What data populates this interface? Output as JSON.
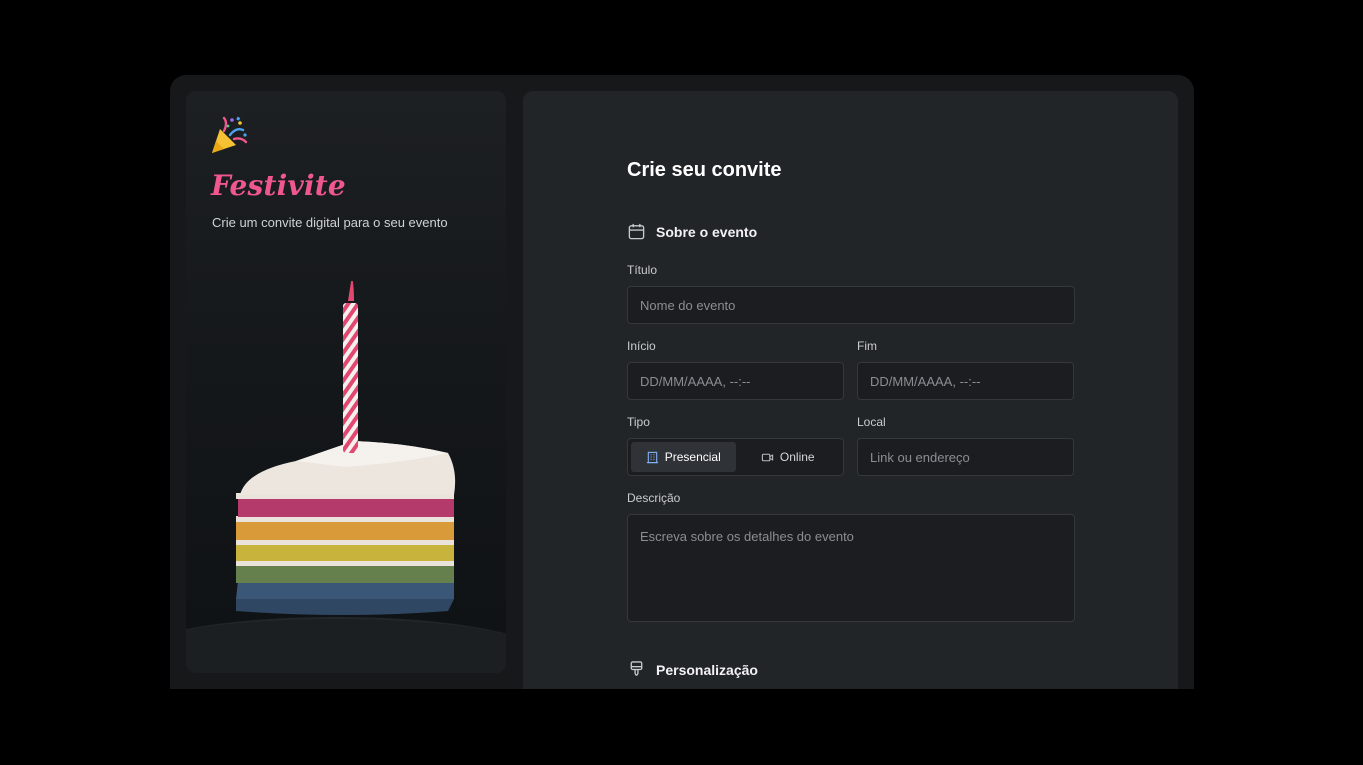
{
  "brand": {
    "name": "Festivite",
    "tagline": "Crie um convite digital para o seu evento",
    "logo_icon": "party-popper-icon",
    "accent_color": "#f0578f"
  },
  "form": {
    "title": "Crie seu convite",
    "section_event": {
      "title": "Sobre o evento",
      "icon": "calendar-icon"
    },
    "fields": {
      "titulo": {
        "label": "Título",
        "placeholder": "Nome do evento"
      },
      "inicio": {
        "label": "Início",
        "placeholder": "DD/MM/AAAA, --:--"
      },
      "fim": {
        "label": "Fim",
        "placeholder": "DD/MM/AAAA, --:--"
      },
      "tipo": {
        "label": "Tipo",
        "options": [
          {
            "label": "Presencial",
            "icon": "building-icon",
            "selected": true
          },
          {
            "label": "Online",
            "icon": "video-icon",
            "selected": false
          }
        ]
      },
      "local": {
        "label": "Local",
        "placeholder": "Link ou endereço"
      },
      "descricao": {
        "label": "Descrição",
        "placeholder": "Escreva sobre os detalhes do evento"
      }
    },
    "section_custom": {
      "title": "Personalização",
      "icon": "paintbrush-icon"
    }
  }
}
